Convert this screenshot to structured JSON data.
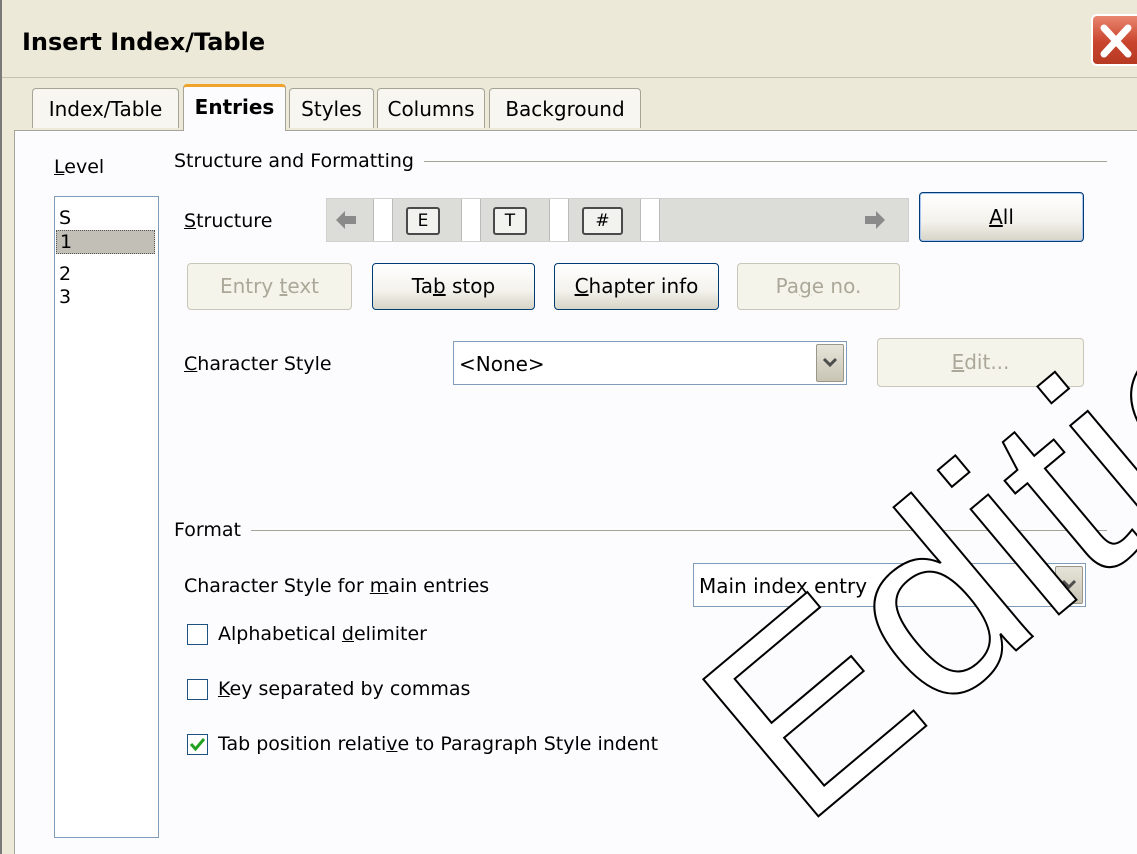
{
  "window": {
    "title": "Insert Index/Table"
  },
  "tabs": [
    {
      "label": "Index/Table",
      "active": false
    },
    {
      "label": "Entries",
      "active": true
    },
    {
      "label": "Styles",
      "active": false
    },
    {
      "label": "Columns",
      "active": false
    },
    {
      "label": "Background",
      "active": false
    }
  ],
  "level": {
    "label_pre": "",
    "label_u": "L",
    "label_post": "evel",
    "items": [
      "S",
      "1",
      "2",
      "3"
    ],
    "selected": "1"
  },
  "structure": {
    "group_title": "Structure and Formatting",
    "label_u": "S",
    "label_post": "tructure",
    "tokens": [
      "E",
      "T",
      "#"
    ],
    "all_button_u": "A",
    "all_button_post": "ll"
  },
  "buttons": {
    "entry_text": {
      "pre": "Entry ",
      "u": "t",
      "post": "ext"
    },
    "tab_stop": {
      "pre": "Ta",
      "u": "b",
      "post": " stop"
    },
    "chapter_info": {
      "pre": "",
      "u": "C",
      "post": "hapter info"
    },
    "page_no": {
      "pre": "Pa",
      "u": "g",
      "post": "e no."
    }
  },
  "character_style": {
    "label_u": "C",
    "label_post": "haracter Style",
    "value": "<None>",
    "edit_u": "E",
    "edit_post": "dit..."
  },
  "format": {
    "group_title": "Format",
    "main_entries_label_pre": "Character Style for ",
    "main_entries_label_u": "m",
    "main_entries_label_post": "ain entries",
    "main_entries_value": "Main index entry",
    "alpha_delim": {
      "pre": "Alphabetical ",
      "u": "d",
      "post": "elimiter",
      "checked": false
    },
    "key_commas": {
      "pre": "",
      "u": "K",
      "post": "ey separated by commas",
      "checked": false
    },
    "tab_position": {
      "pre": "Tab position relati",
      "u": "v",
      "post": "e to Paragraph Style indent",
      "checked": true
    }
  },
  "watermark_text": "Edition",
  "colors": {
    "dialog_bg": "#ece9d8",
    "panel_bg": "#fcfcfe",
    "close_red": "#c9442d",
    "active_tab_accent": "#f0a32a",
    "check_green": "#21a121"
  }
}
